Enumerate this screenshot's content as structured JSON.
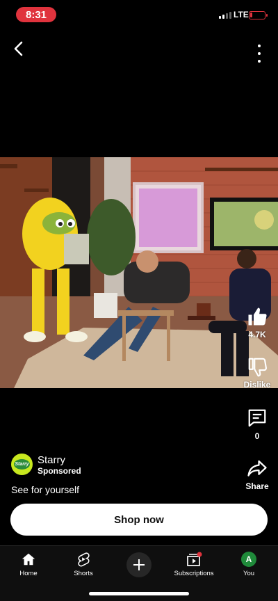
{
  "status_bar": {
    "time": "8:31",
    "network": "LTE"
  },
  "actions": {
    "like_count": "4.7K",
    "dislike_label": "Dislike",
    "comment_count": "0",
    "share_label": "Share"
  },
  "sponsor": {
    "logo_text": "Starry",
    "name": "Starry",
    "label": "Sponsored",
    "caption": "See for yourself",
    "cta": "Shop now"
  },
  "bottom_nav": {
    "home": "Home",
    "shorts": "Shorts",
    "subscriptions": "Subscriptions",
    "you": "You",
    "avatar_letter": "A"
  },
  "colors": {
    "accent_red": "#e0333d",
    "brand_green": "#c8e81f",
    "background": "#000000"
  }
}
